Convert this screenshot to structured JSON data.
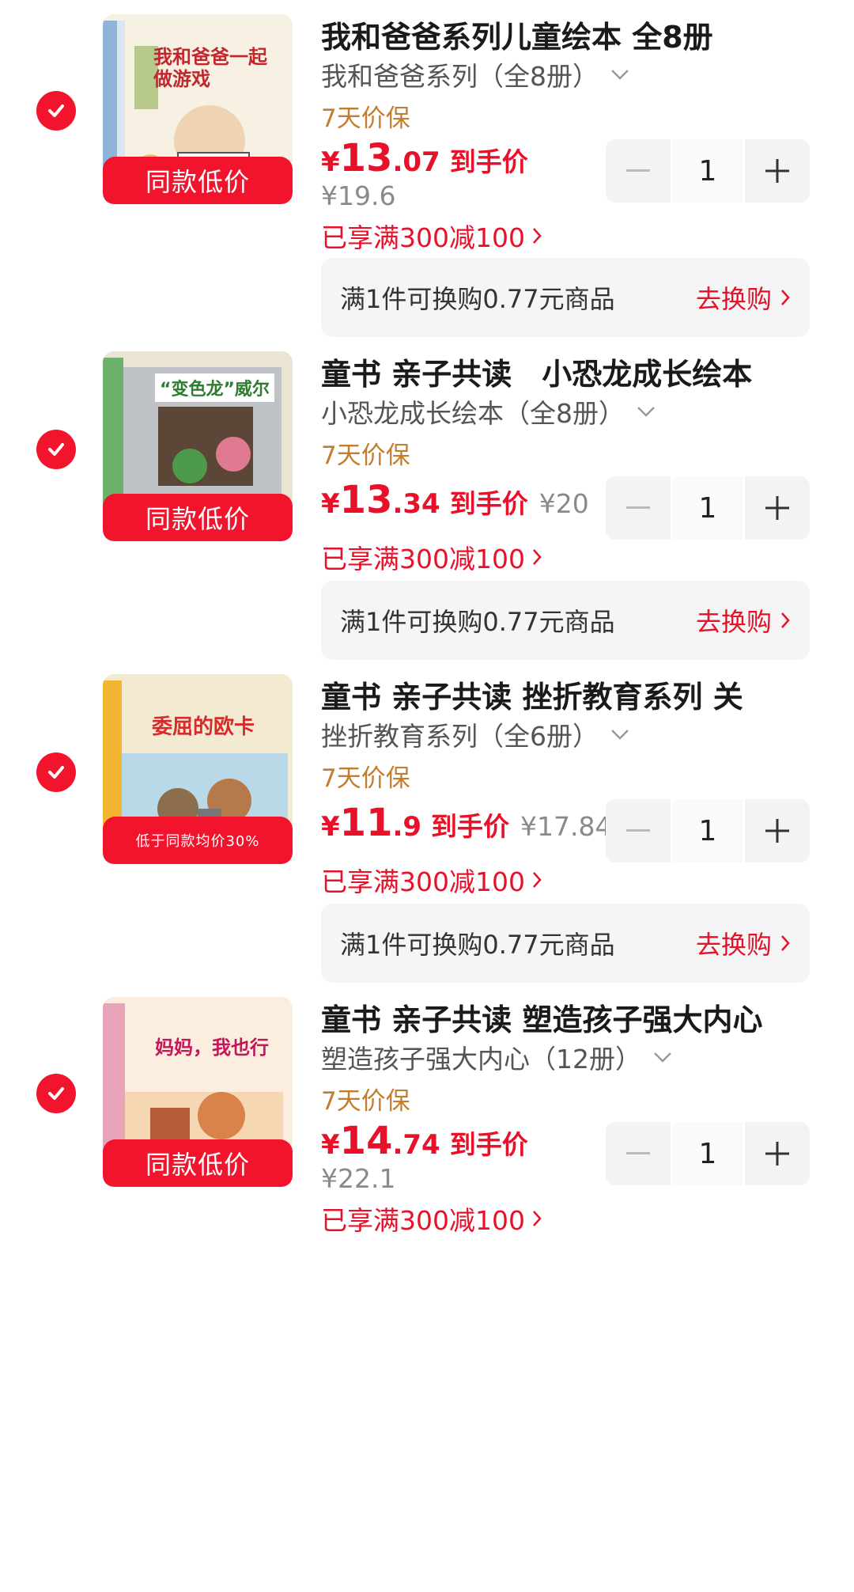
{
  "items": [
    {
      "title": "我和爸爸系列儿童绘本 全8册",
      "spec": "我和爸爸系列（全8册）",
      "tag": "7天价保",
      "price_yen": "¥",
      "price_int": "13",
      "price_dec": ".07",
      "price_label": "到手价",
      "orig_price": "¥19.6",
      "promo": "已享满300减100",
      "qty": "1",
      "exchange_text": "满1件可换购0.77元商品",
      "exchange_btn": "去换购",
      "badge": "同款低价",
      "cover_text": "我和爸爸一起做游戏"
    },
    {
      "title": "童书 亲子共读　小恐龙成长绘本",
      "spec": "小恐龙成长绘本（全8册）",
      "tag": "7天价保",
      "price_yen": "¥",
      "price_int": "13",
      "price_dec": ".34",
      "price_label": "到手价",
      "orig_price": "¥20",
      "promo": "已享满300减100",
      "qty": "1",
      "exchange_text": "满1件可换购0.77元商品",
      "exchange_btn": "去换购",
      "badge": "同款低价",
      "cover_text": "“变色龙”威尔"
    },
    {
      "title": "童书 亲子共读  挫折教育系列 关",
      "spec": "挫折教育系列（全6册）",
      "tag": "7天价保",
      "price_yen": "¥",
      "price_int": "11",
      "price_dec": ".9",
      "price_label": "到手价",
      "orig_price": "¥17.84",
      "promo": "已享满300减100",
      "qty": "1",
      "exchange_text": "满1件可换购0.77元商品",
      "exchange_btn": "去换购",
      "badge": "低于同款均价30%",
      "cover_text": "委屈的欧卡"
    },
    {
      "title": "童书 亲子共读 塑造孩子强大内心",
      "spec": "塑造孩子强大内心（12册）",
      "tag": "7天价保",
      "price_yen": "¥",
      "price_int": "14",
      "price_dec": ".74",
      "price_label": "到手价",
      "orig_price": "¥22.1",
      "promo": "已享满300减100",
      "qty": "1",
      "badge": "同款低价",
      "cover_text": "妈妈，我也行"
    }
  ],
  "colors": {
    "accent": "#e8112a",
    "tag": "#c27e2e",
    "muted": "#8a8a8a"
  },
  "icons": {
    "check": "check-circle-icon",
    "chevron": "chevron-down-icon",
    "arrow": "chevron-right-icon",
    "minus": "minus-icon",
    "plus": "plus-icon"
  }
}
